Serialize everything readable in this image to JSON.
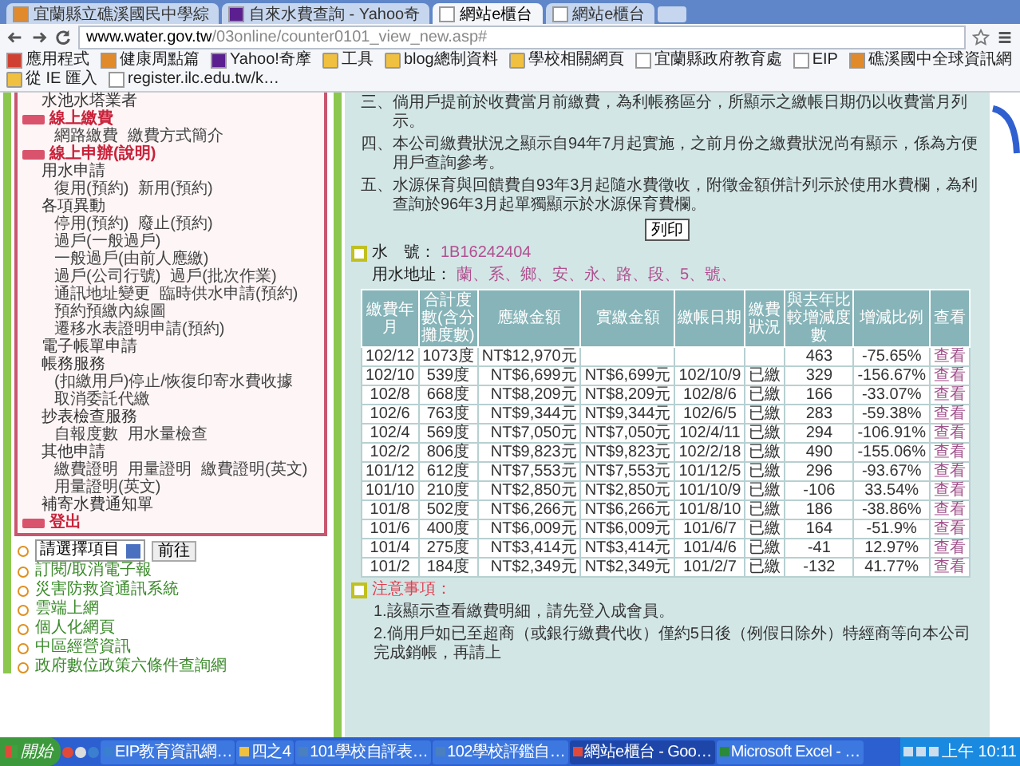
{
  "tabs": [
    {
      "label": "宜蘭縣立礁溪國民中學綜",
      "kind": "site",
      "selected": false
    },
    {
      "label": "自來水費查詢 - Yahoo奇",
      "kind": "yahoo",
      "selected": false
    },
    {
      "label": "網站e櫃台",
      "kind": "page",
      "selected": true
    },
    {
      "label": "網站e櫃台",
      "kind": "page",
      "selected": false
    }
  ],
  "address_bar": {
    "host": "www.water.gov.tw",
    "path": "/03online/counter0101_view_new.asp#"
  },
  "bookmarks": [
    {
      "label": "應用程式",
      "kind": "apps"
    },
    {
      "label": "健康周點篇",
      "kind": "site"
    },
    {
      "label": "Yahoo!奇摩",
      "kind": "yahoo"
    },
    {
      "label": "工具",
      "kind": "folder"
    },
    {
      "label": "blog總制資料",
      "kind": "folder"
    },
    {
      "label": "學校相關網頁",
      "kind": "folder"
    },
    {
      "label": "宜蘭縣政府教育處",
      "kind": "page"
    },
    {
      "label": "EIP",
      "kind": "page"
    },
    {
      "label": "礁溪國中全球資訊網",
      "kind": "site"
    },
    {
      "label": "從 IE 匯入",
      "kind": "folder"
    },
    {
      "label": "register.ilc.edu.tw/k…",
      "kind": "page"
    }
  ],
  "sidebar": {
    "items": [
      {
        "label": "水池水塔業者",
        "kind": "item"
      },
      {
        "label": "線上繳費",
        "kind": "section",
        "children": [
          {
            "label": "網路繳費"
          },
          {
            "label": "繳費方式簡介"
          }
        ]
      },
      {
        "label": "線上申辦(說明)",
        "kind": "section"
      },
      {
        "label": "用水申請",
        "kind": "item",
        "children": [
          {
            "label": "復用(預約)"
          },
          {
            "label": "新用(預約)"
          }
        ]
      },
      {
        "label": "各項異動",
        "kind": "item",
        "children": [
          {
            "label": "停用(預約)"
          },
          {
            "label": "廢止(預約)"
          },
          {
            "label": "過戶(一般過戶)"
          },
          {
            "label": "一般過戶(由前人應繳)"
          },
          {
            "label": "過戶(公司行號)"
          },
          {
            "label": "過戶(批次作業)"
          },
          {
            "label": "通訊地址變更"
          },
          {
            "label": "臨時供水申請(預約)"
          },
          {
            "label": "預約預繳內線圖"
          },
          {
            "label": "遷移水表證明申請(預約)"
          }
        ]
      },
      {
        "label": "電子帳單申請",
        "kind": "item"
      },
      {
        "label": "帳務服務",
        "kind": "item",
        "children": [
          {
            "label": "(扣繳用戶)停止/恢復印寄水費收據"
          },
          {
            "label": "取消委託代繳"
          }
        ]
      },
      {
        "label": "抄表檢查服務",
        "kind": "item",
        "children": [
          {
            "label": "自報度數"
          },
          {
            "label": "用水量檢查"
          }
        ]
      },
      {
        "label": "其他申請",
        "kind": "item",
        "children": [
          {
            "label": "繳費證明"
          },
          {
            "label": "用量證明"
          },
          {
            "label": "繳費證明(英文)"
          },
          {
            "label": "用量證明(英文)"
          }
        ]
      },
      {
        "label": "補寄水費通知單",
        "kind": "item"
      },
      {
        "label": "登出",
        "kind": "section"
      }
    ]
  },
  "quick_links": {
    "select": {
      "value": "請選擇項目",
      "button": "前往"
    },
    "items": [
      "訂閱/取消電子報",
      "災害防救資通訊系統",
      "雲端上網",
      "個人化網頁",
      "中區經營資訊",
      "政府數位政策六條件查詢網"
    ]
  },
  "notes_top": [
    "三、倘用戶提前於收費當月前繳費，為利帳務區分，所顯示之繳帳日期仍以收費當月列示。",
    "四、本公司繳費狀況之顯示自94年7月起實施，之前月份之繳費狀況尚有顯示，係為方便用戶查詢參考。",
    "五、水源保育與回饋費自93年3月起隨水費徵收，附徵金額併計列示於使用水費欄，為利查詢於96年3月起單獨顯示於水源保育費欄。"
  ],
  "print_button": "列印",
  "water_number": {
    "label": "水　號：",
    "value": "1B16242404"
  },
  "address": {
    "label": "用水地址：",
    "value": "蘭、系、鄉、安、永、路、段、5、號、"
  },
  "table": {
    "columns": [
      "繳費年月",
      "合計度數(含分攤度數)",
      "應繳金額",
      "實繳金額",
      "繳帳日期",
      "繳費狀況",
      "與去年比較增減度數",
      "增減比例",
      "查看"
    ],
    "rows": [
      [
        "102/12",
        "1073度",
        "NT$12,970元",
        "",
        "",
        "",
        "463",
        "-75.65%",
        "查看"
      ],
      [
        "102/10",
        "539度",
        "NT$6,699元",
        "NT$6,699元",
        "102/10/9",
        "已繳",
        "329",
        "-156.67%",
        "查看"
      ],
      [
        "102/8",
        "668度",
        "NT$8,209元",
        "NT$8,209元",
        "102/8/6",
        "已繳",
        "166",
        "-33.07%",
        "查看"
      ],
      [
        "102/6",
        "763度",
        "NT$9,344元",
        "NT$9,344元",
        "102/6/5",
        "已繳",
        "283",
        "-59.38%",
        "查看"
      ],
      [
        "102/4",
        "569度",
        "NT$7,050元",
        "NT$7,050元",
        "102/4/11",
        "已繳",
        "294",
        "-106.91%",
        "查看"
      ],
      [
        "102/2",
        "806度",
        "NT$9,823元",
        "NT$9,823元",
        "102/2/18",
        "已繳",
        "490",
        "-155.06%",
        "查看"
      ],
      [
        "101/12",
        "612度",
        "NT$7,553元",
        "NT$7,553元",
        "101/12/5",
        "已繳",
        "296",
        "-93.67%",
        "查看"
      ],
      [
        "101/10",
        "210度",
        "NT$2,850元",
        "NT$2,850元",
        "101/10/9",
        "已繳",
        "-106",
        "33.54%",
        "查看"
      ],
      [
        "101/8",
        "502度",
        "NT$6,266元",
        "NT$6,266元",
        "101/8/10",
        "已繳",
        "186",
        "-38.86%",
        "查看"
      ],
      [
        "101/6",
        "400度",
        "NT$6,009元",
        "NT$6,009元",
        "101/6/7",
        "已繳",
        "164",
        "-51.9%",
        "查看"
      ],
      [
        "101/4",
        "275度",
        "NT$3,414元",
        "NT$3,414元",
        "101/4/6",
        "已繳",
        "-41",
        "12.97%",
        "查看"
      ],
      [
        "101/2",
        "184度",
        "NT$2,349元",
        "NT$2,349元",
        "101/2/7",
        "已繳",
        "-132",
        "41.77%",
        "查看"
      ]
    ]
  },
  "notice": {
    "title": "注意事項：",
    "items": [
      "1.該顯示查看繳費明細，請先登入成會員。",
      "2.倘用戶如已至超商（或銀行繳費代收）僅約5日後（例假日除外）特經商等向本公司完成銷帳，再請上"
    ]
  },
  "taskbar": {
    "start": "開始",
    "tasks": [
      {
        "label": "EIP教育資訊網…",
        "kind": "ie",
        "selected": false
      },
      {
        "label": "四之4",
        "kind": "folder",
        "selected": false
      },
      {
        "label": "101學校自評表…",
        "kind": "doc",
        "selected": false
      },
      {
        "label": "102學校評鑑自…",
        "kind": "doc",
        "selected": false
      },
      {
        "label": "網站e櫃台 - Goo…",
        "kind": "chrome",
        "selected": true
      },
      {
        "label": "Microsoft Excel - …",
        "kind": "excel",
        "selected": false
      }
    ],
    "clock": "上午 10:11"
  }
}
